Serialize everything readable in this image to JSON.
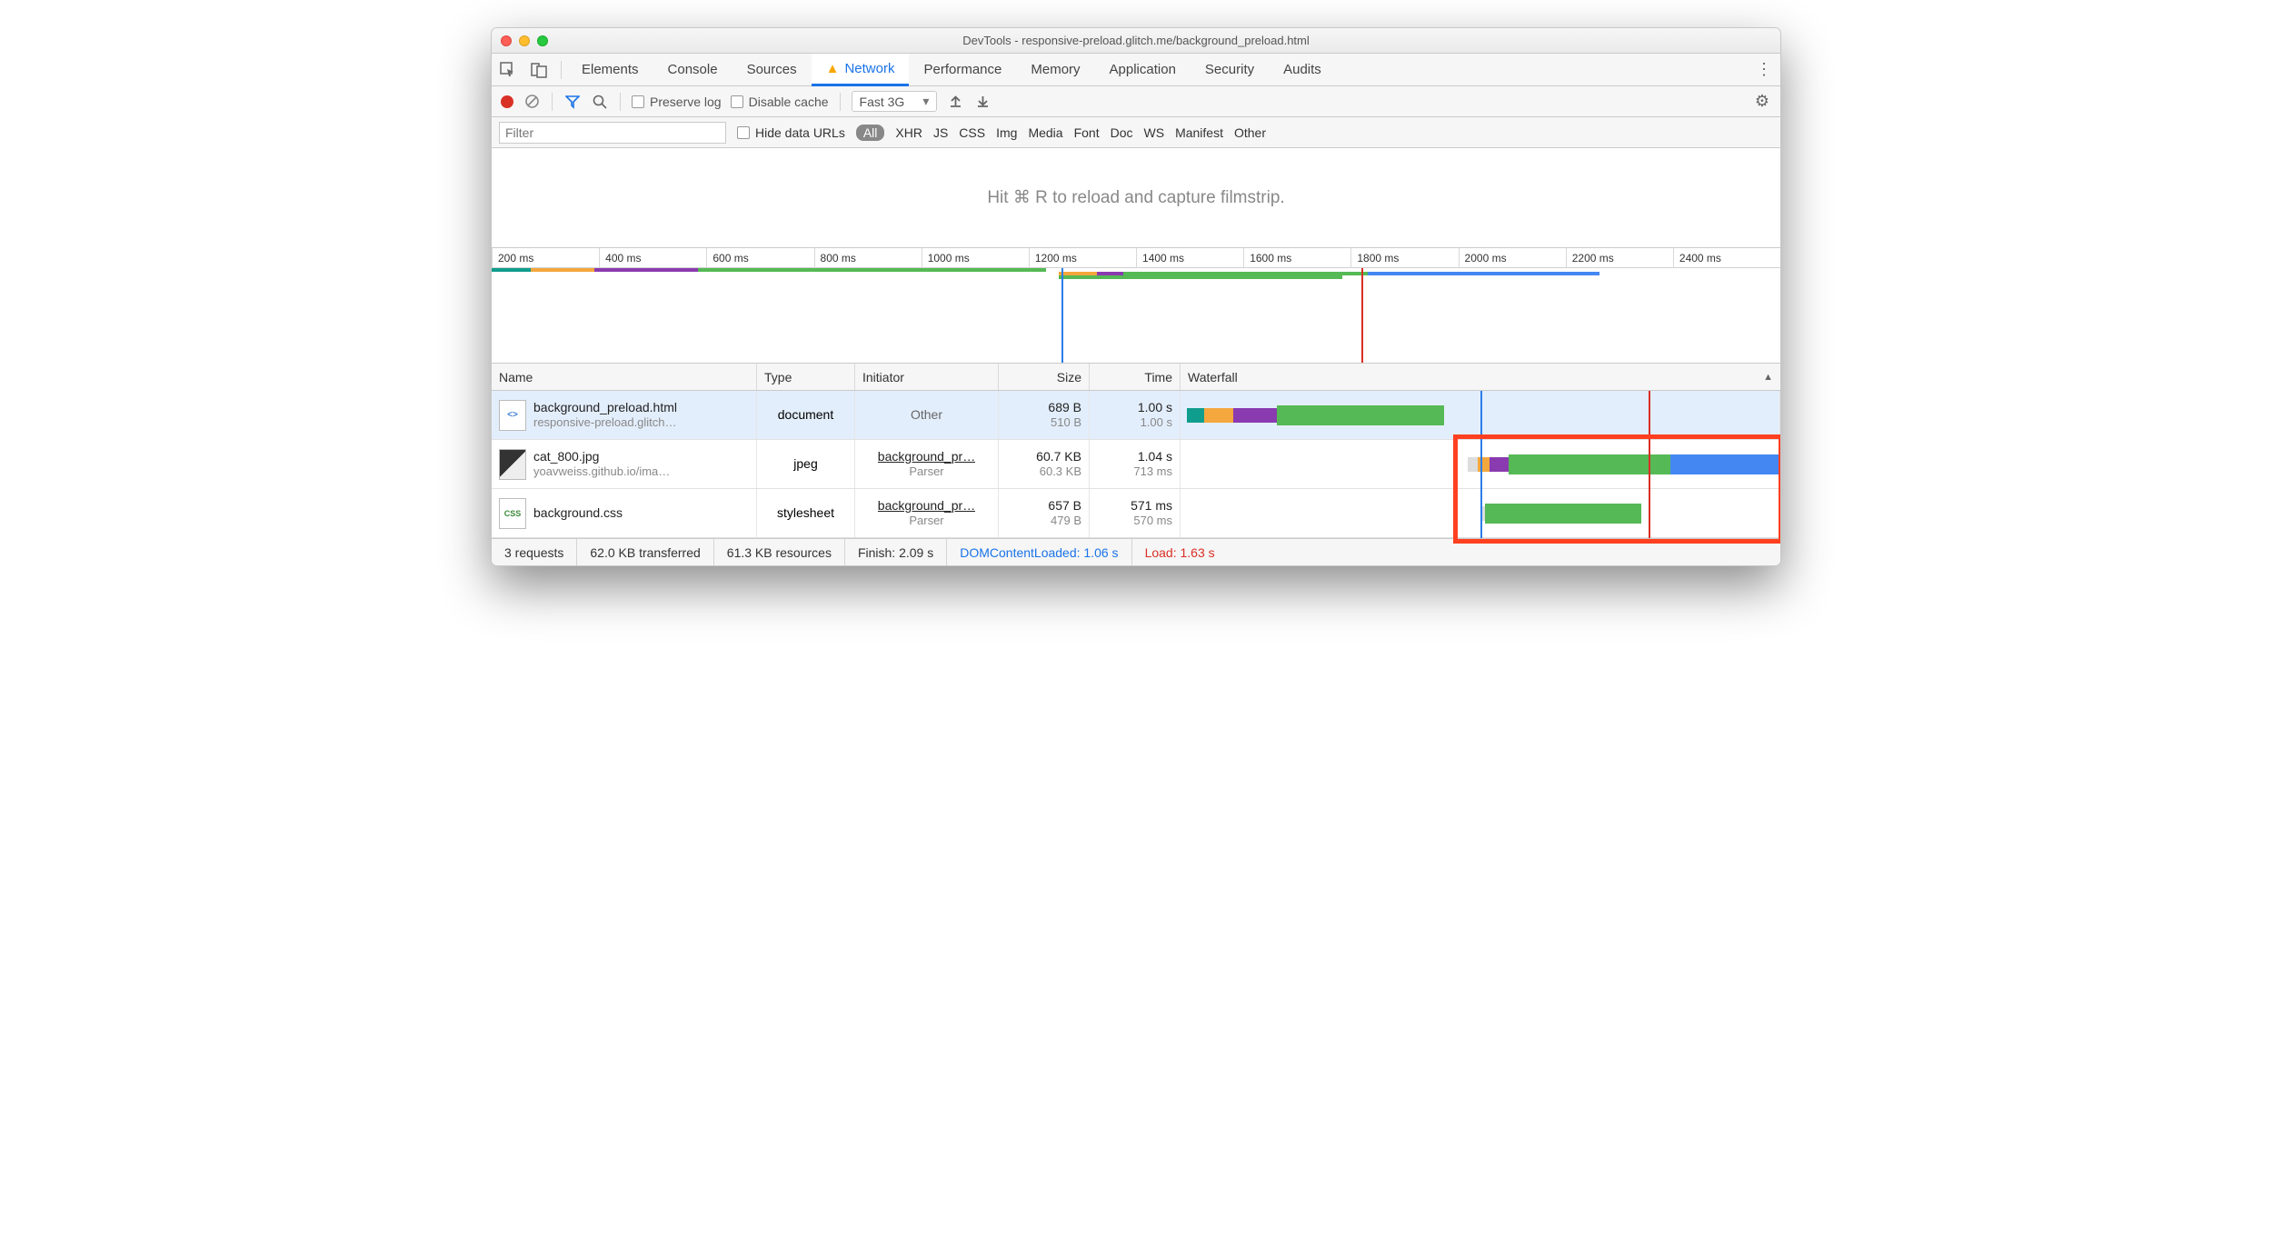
{
  "window": {
    "title": "DevTools - responsive-preload.glitch.me/background_preload.html"
  },
  "tabs": {
    "elements": "Elements",
    "console": "Console",
    "sources": "Sources",
    "network": "Network",
    "performance": "Performance",
    "memory": "Memory",
    "application": "Application",
    "security": "Security",
    "audits": "Audits"
  },
  "toolbar": {
    "preserve_log": "Preserve log",
    "disable_cache": "Disable cache",
    "throttle": "Fast 3G"
  },
  "filterbar": {
    "placeholder": "Filter",
    "hide_data_urls": "Hide data URLs",
    "types": {
      "all": "All",
      "xhr": "XHR",
      "js": "JS",
      "css": "CSS",
      "img": "Img",
      "media": "Media",
      "font": "Font",
      "doc": "Doc",
      "ws": "WS",
      "manifest": "Manifest",
      "other": "Other"
    }
  },
  "filmstrip_hint": "Hit ⌘ R to reload and capture filmstrip.",
  "ruler_ticks": [
    "200 ms",
    "400 ms",
    "600 ms",
    "800 ms",
    "1000 ms",
    "1200 ms",
    "1400 ms",
    "1600 ms",
    "1800 ms",
    "2000 ms",
    "2200 ms",
    "2400 ms"
  ],
  "columns": {
    "name": "Name",
    "type": "Type",
    "initiator": "Initiator",
    "size": "Size",
    "time": "Time",
    "waterfall": "Waterfall"
  },
  "requests": [
    {
      "name": "background_preload.html",
      "sub": "responsive-preload.glitch…",
      "type": "document",
      "initiator": "Other",
      "initiator_sub": "",
      "size": "689 B",
      "size_sub": "510 B",
      "time": "1.00 s",
      "time_sub": "1.00 s"
    },
    {
      "name": "cat_800.jpg",
      "sub": "yoavweiss.github.io/ima…",
      "type": "jpeg",
      "initiator": "background_pr…",
      "initiator_sub": "Parser",
      "size": "60.7 KB",
      "size_sub": "60.3 KB",
      "time": "1.04 s",
      "time_sub": "713 ms"
    },
    {
      "name": "background.css",
      "sub": "",
      "type": "stylesheet",
      "initiator": "background_pr…",
      "initiator_sub": "Parser",
      "size": "657 B",
      "size_sub": "479 B",
      "time": "571 ms",
      "time_sub": "570 ms"
    }
  ],
  "status": {
    "requests": "3 requests",
    "transferred": "62.0 KB transferred",
    "resources": "61.3 KB resources",
    "finish": "Finish: 2.09 s",
    "dcl": "DOMContentLoaded: 1.06 s",
    "load": "Load: 1.63 s"
  }
}
